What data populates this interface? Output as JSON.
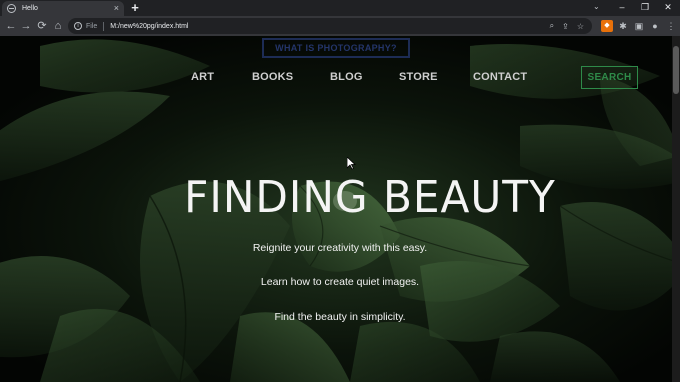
{
  "browser": {
    "tab_title": "Hello",
    "tab_close": "×",
    "new_tab": "+",
    "file_label": "File",
    "url": "M:/new%20pg/index.html",
    "window_controls": [
      "–",
      "❐",
      "✕"
    ],
    "tab_search": "⌄",
    "icons": {
      "back": "←",
      "forward": "→",
      "reload": "⟳",
      "home": "⌂",
      "info": "i",
      "zoom": "⌕",
      "share": "⇪",
      "star": "☆",
      "extensions": "✱",
      "sidepanel": "▣",
      "profile": "●",
      "menu": "⋮"
    }
  },
  "page": {
    "overlay_button": "WHAT IS PHOTOGRAPHY?",
    "nav": {
      "art": "ART",
      "books": "BOOKS",
      "blog": "BLOG",
      "store": "STORE",
      "contact": "CONTACT",
      "search": "SEARCH"
    },
    "hero": {
      "title": "FINDING BEAUTY",
      "line1": "Reignite your creativity with this easy.",
      "line2": "Learn how to create quiet images.",
      "line3": "Find the beauty in simplicity."
    },
    "colors": {
      "search_accent": "#2e8a49",
      "overlay_button": "#1d2c55",
      "chrome_dark": "#202124",
      "chrome_toolbar": "#35363a"
    }
  }
}
